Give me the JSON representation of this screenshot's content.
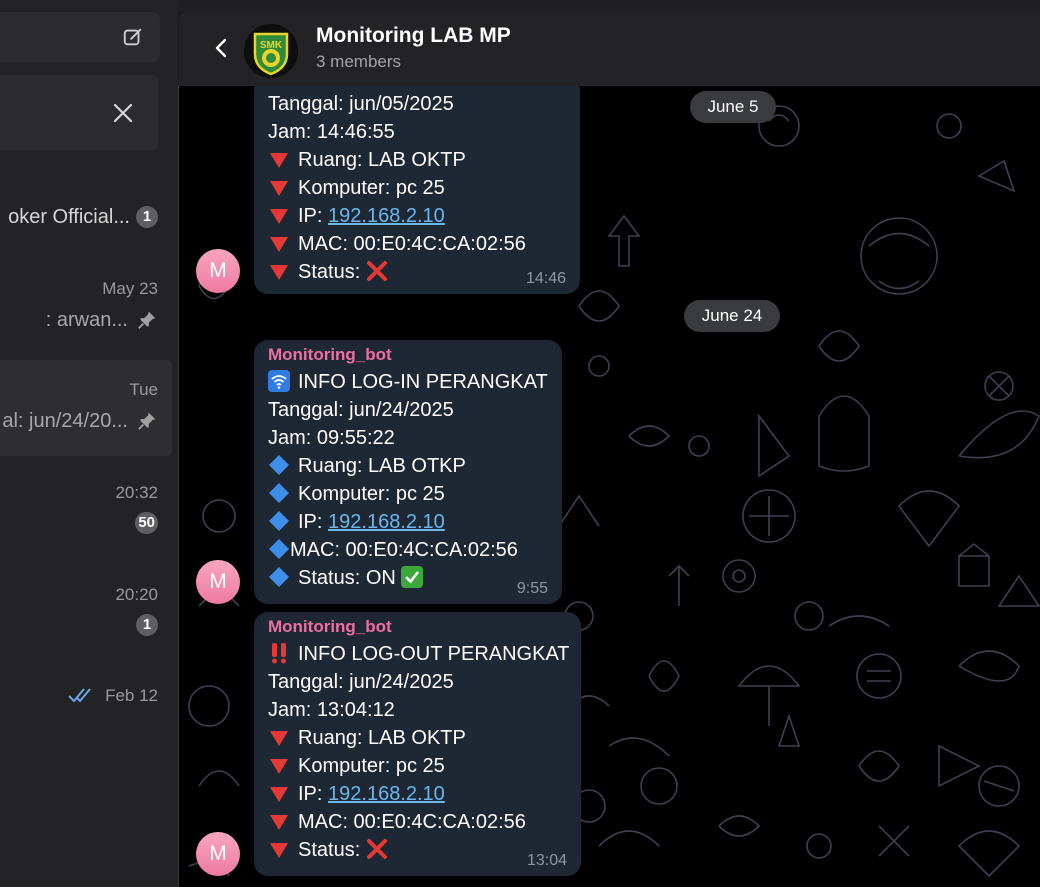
{
  "sidebar": {
    "chats": [
      {
        "title": "oker Official...",
        "time": "",
        "preview": "",
        "badge": "1",
        "pinned": false
      },
      {
        "title": "",
        "time": "May 23",
        "preview": ": arwan...",
        "badge": "",
        "pinned": true
      },
      {
        "title": "",
        "time": "Tue",
        "preview": "al: jun/24/20...",
        "badge": "",
        "pinned": true,
        "active": true
      },
      {
        "title": "",
        "time": "20:32",
        "preview": "",
        "badge": "50",
        "pinned": false
      },
      {
        "title": "",
        "time": "20:20",
        "preview": "",
        "badge": "1",
        "pinned": false
      },
      {
        "title": "",
        "time": "Feb 12",
        "preview": "",
        "badge": "",
        "pinned": false,
        "read": true
      }
    ]
  },
  "header": {
    "title": "Monitoring LAB MP",
    "subtitle": "3 members",
    "avatar_text": "SMK BATIK"
  },
  "dates": [
    "June 5",
    "June 24"
  ],
  "messages": [
    {
      "sender": "",
      "lines": [
        {
          "icon": "",
          "text": "Tanggal: jun/05/2025"
        },
        {
          "icon": "",
          "text": "Jam: 14:46:55"
        },
        {
          "icon": "red-triangle",
          "text": "Ruang: LAB OKTP"
        },
        {
          "icon": "red-triangle",
          "text": "Komputer: pc 25"
        },
        {
          "icon": "red-triangle",
          "label": "IP: ",
          "link": "192.168.2.10"
        },
        {
          "icon": "red-triangle",
          "text": "MAC: 00:E0:4C:CA:02:56"
        },
        {
          "icon": "red-triangle",
          "text": "Status: ",
          "suffix": "cross"
        }
      ],
      "time": "14:46",
      "avatar": "M"
    },
    {
      "sender": "Monitoring_bot",
      "lines": [
        {
          "icon": "wifi",
          "text": "INFO LOG-IN PERANGKAT"
        },
        {
          "icon": "",
          "text": "Tanggal: jun/24/2025"
        },
        {
          "icon": "",
          "text": "Jam: 09:55:22"
        },
        {
          "icon": "blue-diamond",
          "text": "Ruang: LAB OTKP"
        },
        {
          "icon": "blue-diamond",
          "text": "Komputer: pc 25"
        },
        {
          "icon": "blue-diamond",
          "label": "IP: ",
          "link": "192.168.2.10"
        },
        {
          "icon": "blue-diamond",
          "text": "MAC: 00:E0:4C:CA:02:56"
        },
        {
          "icon": "blue-diamond",
          "text": "Status: ON ",
          "suffix": "check"
        }
      ],
      "time": "9:55",
      "avatar": "M"
    },
    {
      "sender": "Monitoring_bot",
      "lines": [
        {
          "icon": "double-exclamation",
          "text": "INFO LOG-OUT PERANGKAT"
        },
        {
          "icon": "",
          "text": "Tanggal: jun/24/2025"
        },
        {
          "icon": "",
          "text": "Jam: 13:04:12"
        },
        {
          "icon": "red-triangle",
          "text": "Ruang: LAB OKTP"
        },
        {
          "icon": "red-triangle",
          "text": "Komputer: pc 25"
        },
        {
          "icon": "red-triangle",
          "label": "IP: ",
          "link": "192.168.2.10"
        },
        {
          "icon": "red-triangle",
          "text": "MAC: 00:E0:4C:CA:02:56"
        },
        {
          "icon": "red-triangle",
          "text": "Status: ",
          "suffix": "cross"
        }
      ],
      "time": "13:04",
      "avatar": "M"
    }
  ],
  "colors": {
    "accent": "#6ab7ee",
    "sender": "#ee6ea0",
    "bubble": "#1e2734",
    "background": "#000000"
  }
}
